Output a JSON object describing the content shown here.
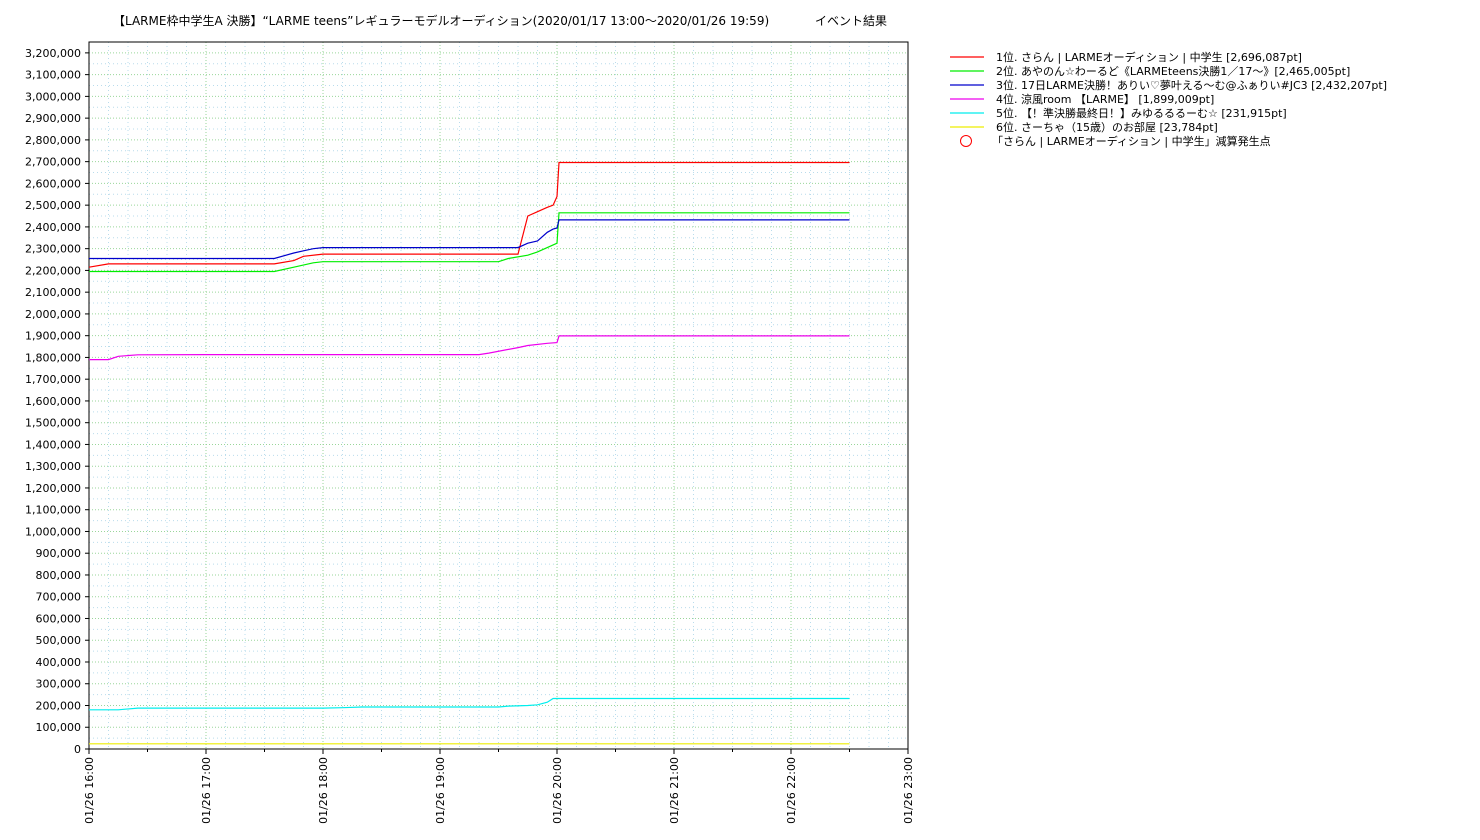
{
  "title_main": "【LARME枠中学生A 決勝】“LARME teens”レギュラーモデルオーディション(2020/01/17 13:00〜2020/01/26 19:59)",
  "title_suffix": "イベント結果",
  "chart_data": {
    "type": "line",
    "title": "【LARME枠中学生A 決勝】“LARME teens”レギュラーモデルオーディション(2020/01/17 13:00〜2020/01/26 19:59)　イベント結果",
    "xlabel": "",
    "ylabel": "",
    "x_axis": "time (01/26)",
    "xlim": [
      "16:00",
      "23:00"
    ],
    "ylim": [
      0,
      3250000
    ],
    "x_ticks": [
      "01/26 16:00",
      "01/26 17:00",
      "01/26 18:00",
      "01/26 19:00",
      "01/26 20:00",
      "01/26 21:00",
      "01/26 22:00",
      "01/26 23:00"
    ],
    "y_ticks": [
      "0",
      "100,000",
      "200,000",
      "300,000",
      "400,000",
      "500,000",
      "600,000",
      "700,000",
      "800,000",
      "900,000",
      "1,000,000",
      "1,100,000",
      "1,200,000",
      "1,300,000",
      "1,400,000",
      "1,500,000",
      "1,600,000",
      "1,700,000",
      "1,800,000",
      "1,900,000",
      "2,000,000",
      "2,100,000",
      "2,200,000",
      "2,300,000",
      "2,400,000",
      "2,500,000",
      "2,600,000",
      "2,700,000",
      "2,800,000",
      "2,900,000",
      "3,000,000",
      "3,100,000",
      "3,200,000"
    ],
    "grid": true,
    "legend_position": "outside-right-top",
    "series": [
      {
        "name": "1位. さらん | LARMEオーディション | 中学生 [2,696,087pt]",
        "color": "#ff0000",
        "points": [
          [
            "16:00",
            2215000
          ],
          [
            "16:10",
            2230000
          ],
          [
            "17:00",
            2230000
          ],
          [
            "17:35",
            2230000
          ],
          [
            "17:45",
            2245000
          ],
          [
            "17:50",
            2265000
          ],
          [
            "18:00",
            2275000
          ],
          [
            "19:00",
            2275000
          ],
          [
            "19:34",
            2275000
          ],
          [
            "19:40",
            2275000
          ],
          [
            "19:45",
            2450000
          ],
          [
            "19:50",
            2470000
          ],
          [
            "19:55",
            2490000
          ],
          [
            "19:58",
            2500000
          ],
          [
            "20:00",
            2540000
          ],
          [
            "20:01",
            2696087
          ],
          [
            "22:30",
            2696087
          ]
        ]
      },
      {
        "name": "2位. あやのん☆わーるど《LARMEteens決勝1／17〜》[2,465,005pt]",
        "color": "#00ee00",
        "points": [
          [
            "16:00",
            2195000
          ],
          [
            "17:35",
            2195000
          ],
          [
            "17:45",
            2215000
          ],
          [
            "17:55",
            2235000
          ],
          [
            "18:00",
            2240000
          ],
          [
            "19:00",
            2240000
          ],
          [
            "19:30",
            2240000
          ],
          [
            "19:35",
            2255000
          ],
          [
            "19:45",
            2270000
          ],
          [
            "19:50",
            2285000
          ],
          [
            "20:00",
            2325000
          ],
          [
            "20:01",
            2465005
          ],
          [
            "22:30",
            2465005
          ]
        ]
      },
      {
        "name": "3位. 17日LARME決勝！ありい♡夢叶える〜む@ふぁりい#JC3 [2,432,207pt]",
        "color": "#0000cc",
        "points": [
          [
            "16:00",
            2255000
          ],
          [
            "17:35",
            2255000
          ],
          [
            "17:45",
            2280000
          ],
          [
            "17:50",
            2290000
          ],
          [
            "17:55",
            2300000
          ],
          [
            "18:00",
            2305000
          ],
          [
            "19:00",
            2305000
          ],
          [
            "19:40",
            2305000
          ],
          [
            "19:45",
            2325000
          ],
          [
            "19:50",
            2335000
          ],
          [
            "19:55",
            2375000
          ],
          [
            "19:58",
            2390000
          ],
          [
            "20:00",
            2395000
          ],
          [
            "20:01",
            2432207
          ],
          [
            "22:30",
            2432207
          ]
        ]
      },
      {
        "name": "4位. 涼風room 【LARME】 [1,899,009pt]",
        "color": "#ee00ee",
        "points": [
          [
            "16:00",
            1790000
          ],
          [
            "16:10",
            1790000
          ],
          [
            "16:15",
            1805000
          ],
          [
            "16:25",
            1812000
          ],
          [
            "17:00",
            1813000
          ],
          [
            "19:00",
            1813000
          ],
          [
            "19:20",
            1813000
          ],
          [
            "19:25",
            1820000
          ],
          [
            "19:40",
            1845000
          ],
          [
            "19:45",
            1855000
          ],
          [
            "19:55",
            1865000
          ],
          [
            "20:00",
            1868000
          ],
          [
            "20:01",
            1899009
          ],
          [
            "22:30",
            1899009
          ]
        ]
      },
      {
        "name": "5位. 【！準決勝最終日！】みゆるるるーむ☆ [231,915pt]",
        "color": "#00eeee",
        "points": [
          [
            "16:00",
            180000
          ],
          [
            "16:15",
            180000
          ],
          [
            "16:25",
            188000
          ],
          [
            "17:00",
            188000
          ],
          [
            "18:00",
            188000
          ],
          [
            "18:10",
            190000
          ],
          [
            "18:20",
            193000
          ],
          [
            "19:00",
            193000
          ],
          [
            "19:30",
            193000
          ],
          [
            "19:35",
            197000
          ],
          [
            "19:45",
            200000
          ],
          [
            "19:50",
            203000
          ],
          [
            "19:55",
            215000
          ],
          [
            "19:58",
            231915
          ],
          [
            "22:30",
            231915
          ]
        ]
      },
      {
        "name": "6位. さーちゃ（15歳）のお部屋 [23,784pt]",
        "color": "#eeee00",
        "points": [
          [
            "16:00",
            23784
          ],
          [
            "22:30",
            23784
          ]
        ]
      }
    ],
    "markers": {
      "name": "「さらん | LARMEオーディション | 中学生」減算発生点",
      "color": "#ff0000",
      "points": []
    }
  }
}
